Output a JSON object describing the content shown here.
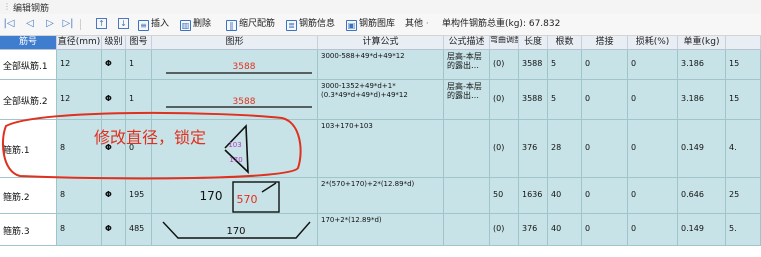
{
  "window": {
    "title": "编辑钢筋"
  },
  "toolbar": {
    "insert": "插入",
    "delete": "删除",
    "scale_rebar": "缩尺配筋",
    "rebar_info": "钢筋信息",
    "rebar_library": "钢筋图库",
    "other": "其他",
    "other_arrow": "·",
    "total_weight": "单构件钢筋总重(kg): 67.832"
  },
  "headers": [
    "筋号",
    "直径(mm)",
    "级别",
    "图号",
    "图形",
    "计算公式",
    "公式描述",
    "弯曲调整",
    "长度",
    "根数",
    "搭接",
    "损耗(%)",
    "单重(kg)",
    ""
  ],
  "rows": [
    {
      "name": "全部纵筋.1",
      "diameter": "12",
      "grade": "Φ",
      "fig": "1",
      "shape_label": "3588",
      "formula": "3000-588+49*d+49*12",
      "desc": "层高-本层的露出…",
      "adjust": "(0)",
      "length": "3588",
      "count": "5",
      "lap": "0",
      "loss": "0",
      "unit_weight": "3.186",
      "total": "15"
    },
    {
      "name": "全部纵筋.2",
      "diameter": "12",
      "grade": "Φ",
      "fig": "1",
      "shape_label": "3588",
      "formula": "3000-1352+49*d+1*(0.3*49*d+49*d)+49*12",
      "desc": "层高-本层的露出…",
      "adjust": "(0)",
      "length": "3588",
      "count": "5",
      "lap": "0",
      "loss": "0",
      "unit_weight": "3.186",
      "total": "15"
    },
    {
      "name": "箍筋.1",
      "diameter": "8",
      "grade": "Φ",
      "fig": "0",
      "shape_label": "103",
      "shape_label2": "170",
      "formula": "103+170+103",
      "desc": "",
      "adjust": "(0)",
      "length": "376",
      "count": "28",
      "lap": "0",
      "loss": "0",
      "unit_weight": "0.149",
      "total": "4."
    },
    {
      "name": "箍筋.2",
      "diameter": "8",
      "grade": "Φ",
      "fig": "195",
      "shape_label": "170",
      "shape_label2": "570",
      "formula": "2*(570+170)+2*(12.89*d)",
      "desc": "",
      "adjust": "50",
      "length": "1636",
      "count": "40",
      "lap": "0",
      "loss": "0",
      "unit_weight": "0.646",
      "total": "25"
    },
    {
      "name": "箍筋.3",
      "diameter": "8",
      "grade": "Φ",
      "fig": "485",
      "shape_label": "170",
      "formula": "170+2*(12.89*d)",
      "desc": "",
      "adjust": "(0)",
      "length": "376",
      "count": "40",
      "lap": "0",
      "loss": "0",
      "unit_weight": "0.149",
      "total": "5."
    }
  ],
  "annotation": {
    "text": "修改直径，锁定",
    "color": "#e0301e"
  },
  "colors": {
    "row_bg": "#c7e3e7",
    "header_selected": "#3f7ecf",
    "shape_red": "#e0301e",
    "shape_purple": "#b040c0"
  }
}
